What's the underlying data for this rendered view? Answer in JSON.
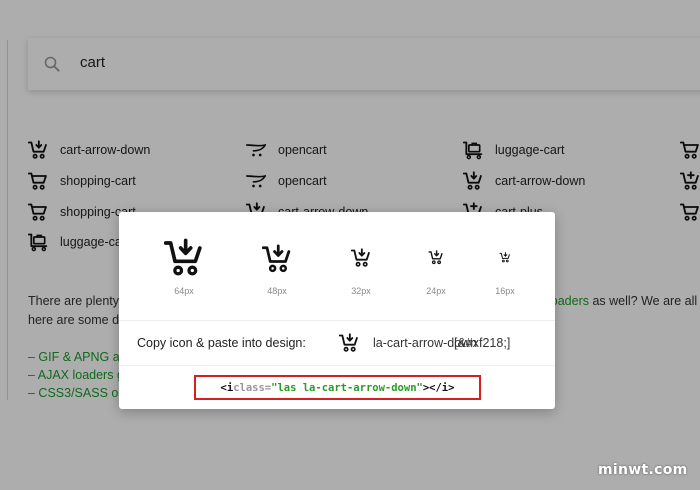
{
  "search": {
    "value": "cart"
  },
  "results": [
    {
      "label": "cart-arrow-down",
      "icon": "cart-arrow-down-icon"
    },
    {
      "label": "opencart",
      "icon": "opencart-icon"
    },
    {
      "label": "luggage-cart",
      "icon": "luggage-cart-icon"
    },
    {
      "label": "shopping-cart",
      "icon": "shopping-cart-icon"
    },
    {
      "label": "opencart",
      "icon": "opencart-icon"
    },
    {
      "label": "cart-arrow-down",
      "icon": "cart-arrow-down-icon"
    },
    {
      "label": "shopping-cart",
      "icon": "shopping-cart-icon"
    },
    {
      "label": "cart-arrow-down",
      "icon": "cart-arrow-down-icon"
    },
    {
      "label": "cart-plus",
      "icon": "cart-plus-icon"
    },
    {
      "label": "luggage-cart",
      "icon": "luggage-cart-icon"
    }
  ],
  "body": {
    "line1_start": "There are plenty o",
    "line1_link": "loaders",
    "line1_end": " as well? We are all a",
    "line2_start": "here are some do"
  },
  "links": [
    "– GIF & APNG ani",
    "– AJAX loaders ge",
    "– CSS3/SASS obj"
  ],
  "modal": {
    "sizes": [
      "64px",
      "48px",
      "32px",
      "24px",
      "16px"
    ],
    "copy_label": "Copy icon & paste into design:",
    "icon_name": "la-cart-arrow-down",
    "icon_code": "[&#xf218;]",
    "code": {
      "open": "<i ",
      "attr": "class=",
      "value": "\"las la-cart-arrow-down\"",
      "close": "></i>"
    }
  },
  "watermark": "minwt.com",
  "colors": {
    "link": "#1a9a2a",
    "highlight_border": "#d42020"
  }
}
